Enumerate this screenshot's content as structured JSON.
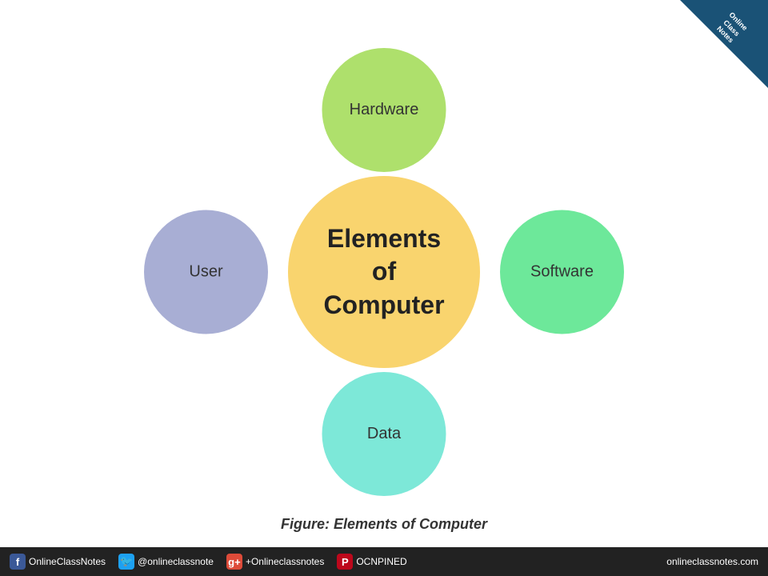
{
  "badge": {
    "line1": "Online",
    "line2": "Class",
    "line3": "Notes"
  },
  "diagram": {
    "center_label": "Elements\nof\nComputer",
    "top_label": "Hardware",
    "right_label": "Software",
    "bottom_label": "Data",
    "left_label": "User"
  },
  "caption": {
    "text": "Figure: Elements of Computer"
  },
  "footer": {
    "fb_label": "OnlineClassNotes",
    "tw_label": "@onlineclassnote",
    "gp_label": "+Onlineclassnotes",
    "pi_label": "OCNPINED",
    "right_label": "onlineclassnotes.com"
  }
}
